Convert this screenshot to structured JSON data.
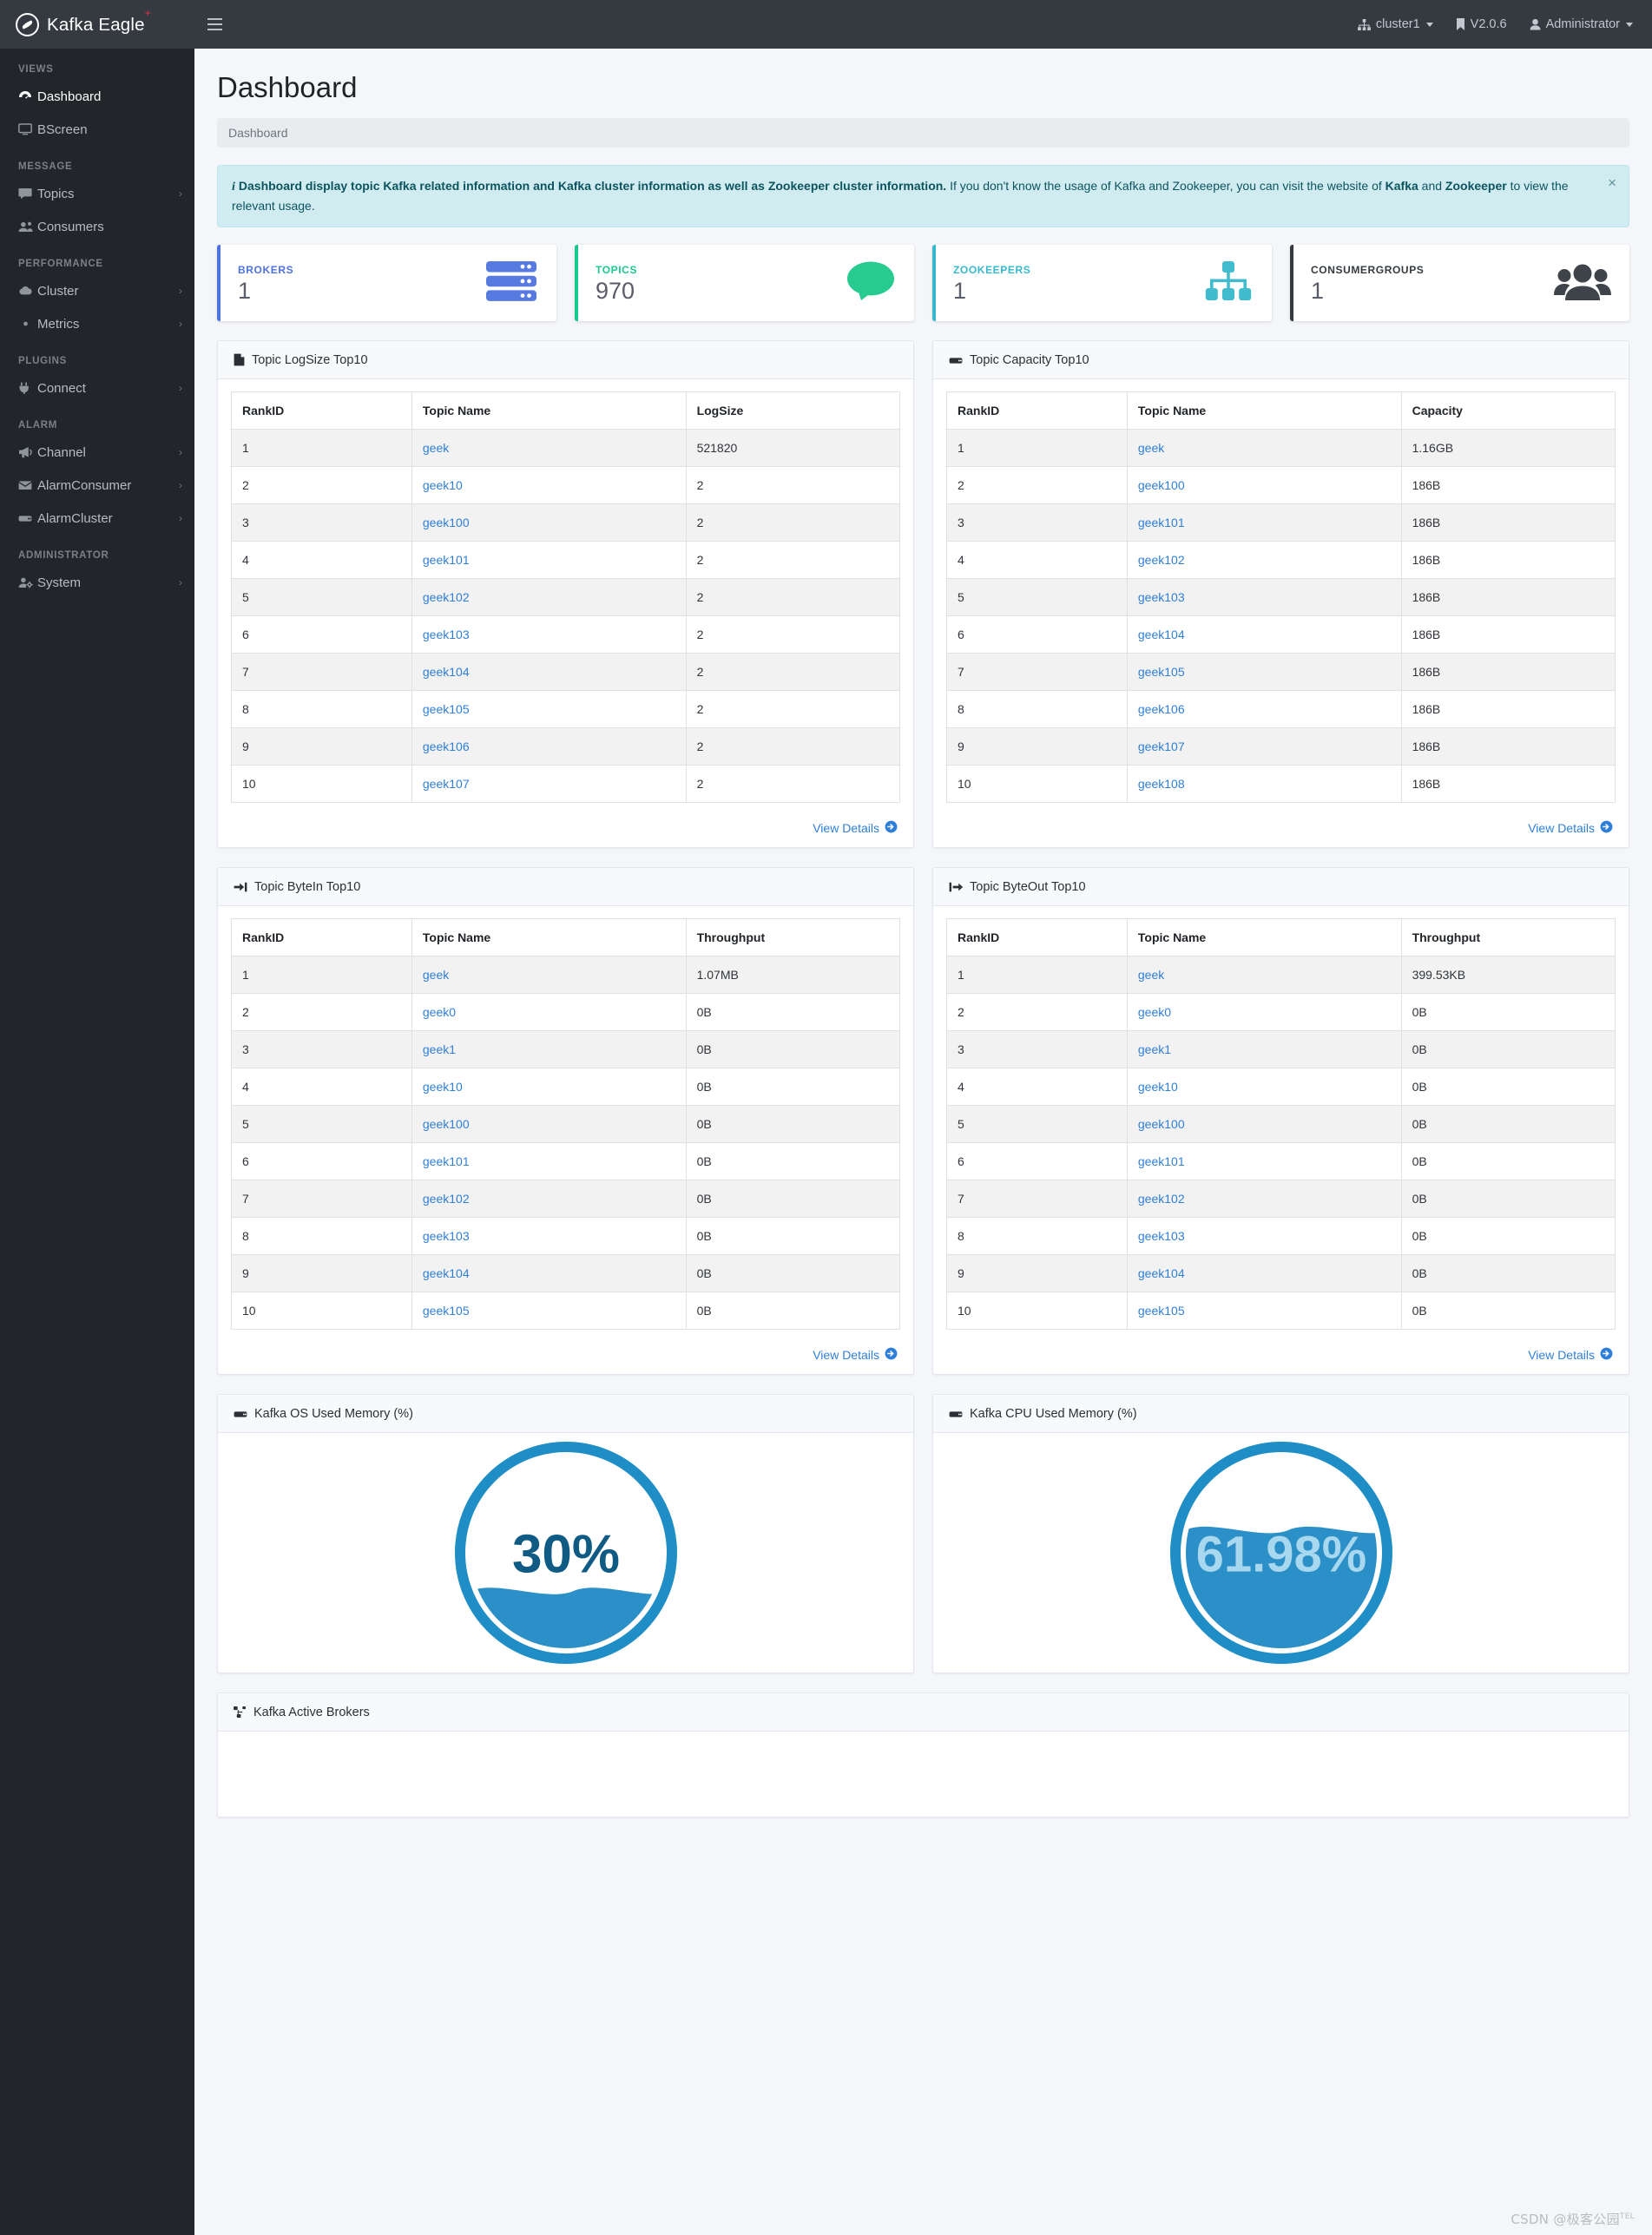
{
  "topnav": {
    "brand": "Kafka Eagle",
    "brand_sup": "+",
    "cluster": "cluster1",
    "version": "V2.0.6",
    "user": "Administrator"
  },
  "sidebar": {
    "sections": [
      {
        "heading": "VIEWS",
        "items": [
          {
            "label": "Dashboard",
            "icon": "dashboard-icon",
            "arrow": "",
            "active": true
          },
          {
            "label": "BScreen",
            "icon": "monitor-icon",
            "arrow": "",
            "active": false
          }
        ]
      },
      {
        "heading": "MESSAGE",
        "items": [
          {
            "label": "Topics",
            "icon": "comment-icon",
            "arrow": "›",
            "active": false
          },
          {
            "label": "Consumers",
            "icon": "users-icon",
            "arrow": "",
            "active": false
          }
        ]
      },
      {
        "heading": "PERFORMANCE",
        "items": [
          {
            "label": "Cluster",
            "icon": "cloud-icon",
            "arrow": "›",
            "active": false
          },
          {
            "label": "Metrics",
            "icon": "eye-icon",
            "arrow": "›",
            "active": false
          }
        ]
      },
      {
        "heading": "PLUGINS",
        "items": [
          {
            "label": "Connect",
            "icon": "plug-icon",
            "arrow": "›",
            "active": false
          }
        ]
      },
      {
        "heading": "ALARM",
        "items": [
          {
            "label": "Channel",
            "icon": "megaphone-icon",
            "arrow": "›",
            "active": false
          },
          {
            "label": "AlarmConsumer",
            "icon": "envelope-icon",
            "arrow": "›",
            "active": false
          },
          {
            "label": "AlarmCluster",
            "icon": "server-icon",
            "arrow": "›",
            "active": false
          }
        ]
      },
      {
        "heading": "ADMINISTRATOR",
        "items": [
          {
            "label": "System",
            "icon": "user-cog-icon",
            "arrow": "›",
            "active": false
          }
        ]
      }
    ]
  },
  "page": {
    "title": "Dashboard",
    "breadcrumb": "Dashboard"
  },
  "alert": {
    "part1": "Dashboard display topic Kafka related information and Kafka cluster information as well as Zookeeper cluster information.",
    "part2": "If you don't know the usage of Kafka and Zookeeper, you can visit the website of",
    "link1": "Kafka",
    "part3": "and",
    "link2": "Zookeeper",
    "part4": "to view the relevant usage.",
    "close": "×"
  },
  "stats": [
    {
      "label": "BROKERS",
      "value": "1",
      "color": "#4e73df",
      "icon": "server-stack-icon"
    },
    {
      "label": "TOPICS",
      "value": "970",
      "color": "#1cc88a",
      "icon": "comment-bubble-icon"
    },
    {
      "label": "ZOOKEEPERS",
      "value": "1",
      "color": "#36b9cc",
      "icon": "sitemap-icon"
    },
    {
      "label": "CONSUMERGROUPS",
      "value": "1",
      "color": "#343a40",
      "icon": "users-group-icon"
    }
  ],
  "tables": {
    "logsize": {
      "title": "Topic LogSize Top10",
      "icon": "file-icon",
      "columns": [
        "RankID",
        "Topic Name",
        "LogSize"
      ],
      "rows": [
        [
          "1",
          "geek",
          "521820"
        ],
        [
          "2",
          "geek10",
          "2"
        ],
        [
          "3",
          "geek100",
          "2"
        ],
        [
          "4",
          "geek101",
          "2"
        ],
        [
          "5",
          "geek102",
          "2"
        ],
        [
          "6",
          "geek103",
          "2"
        ],
        [
          "7",
          "geek104",
          "2"
        ],
        [
          "8",
          "geek105",
          "2"
        ],
        [
          "9",
          "geek106",
          "2"
        ],
        [
          "10",
          "geek107",
          "2"
        ]
      ],
      "footer_link": "View Details"
    },
    "capacity": {
      "title": "Topic Capacity Top10",
      "icon": "server-icon",
      "columns": [
        "RankID",
        "Topic Name",
        "Capacity"
      ],
      "rows": [
        [
          "1",
          "geek",
          "1.16GB"
        ],
        [
          "2",
          "geek100",
          "186B"
        ],
        [
          "3",
          "geek101",
          "186B"
        ],
        [
          "4",
          "geek102",
          "186B"
        ],
        [
          "5",
          "geek103",
          "186B"
        ],
        [
          "6",
          "geek104",
          "186B"
        ],
        [
          "7",
          "geek105",
          "186B"
        ],
        [
          "8",
          "geek106",
          "186B"
        ],
        [
          "9",
          "geek107",
          "186B"
        ],
        [
          "10",
          "geek108",
          "186B"
        ]
      ],
      "footer_link": "View Details"
    },
    "bytein": {
      "title": "Topic ByteIn Top10",
      "icon": "sign-in-icon",
      "columns": [
        "RankID",
        "Topic Name",
        "Throughput"
      ],
      "rows": [
        [
          "1",
          "geek",
          "1.07MB"
        ],
        [
          "2",
          "geek0",
          "0B"
        ],
        [
          "3",
          "geek1",
          "0B"
        ],
        [
          "4",
          "geek10",
          "0B"
        ],
        [
          "5",
          "geek100",
          "0B"
        ],
        [
          "6",
          "geek101",
          "0B"
        ],
        [
          "7",
          "geek102",
          "0B"
        ],
        [
          "8",
          "geek103",
          "0B"
        ],
        [
          "9",
          "geek104",
          "0B"
        ],
        [
          "10",
          "geek105",
          "0B"
        ]
      ],
      "footer_link": "View Details"
    },
    "byteout": {
      "title": "Topic ByteOut Top10",
      "icon": "sign-out-icon",
      "columns": [
        "RankID",
        "Topic Name",
        "Throughput"
      ],
      "rows": [
        [
          "1",
          "geek",
          "399.53KB"
        ],
        [
          "2",
          "geek0",
          "0B"
        ],
        [
          "3",
          "geek1",
          "0B"
        ],
        [
          "4",
          "geek10",
          "0B"
        ],
        [
          "5",
          "geek100",
          "0B"
        ],
        [
          "6",
          "geek101",
          "0B"
        ],
        [
          "7",
          "geek102",
          "0B"
        ],
        [
          "8",
          "geek103",
          "0B"
        ],
        [
          "9",
          "geek104",
          "0B"
        ],
        [
          "10",
          "geek105",
          "0B"
        ]
      ],
      "footer_link": "View Details"
    }
  },
  "gauges": {
    "os_memory": {
      "title": "Kafka OS Used Memory (%)",
      "icon": "server-icon",
      "label": "30%",
      "percent": 30
    },
    "cpu_memory": {
      "title": "Kafka CPU Used Memory (%)",
      "icon": "server-icon",
      "label": "61.98%",
      "percent": 61.98
    }
  },
  "active_brokers": {
    "title": "Kafka Active Brokers",
    "icon": "project-diagram-icon"
  },
  "watermark": {
    "text": "CSDN @极客公园",
    "sup": "TEL"
  },
  "chart_data": [
    {
      "type": "gauge",
      "title": "Kafka OS Used Memory (%)",
      "values": [
        30
      ],
      "labels": [
        "30%"
      ],
      "ylim": [
        0,
        100
      ],
      "style": "liquid-fill",
      "color": "#1f8dc6"
    },
    {
      "type": "gauge",
      "title": "Kafka CPU Used Memory (%)",
      "values": [
        61.98
      ],
      "labels": [
        "61.98%"
      ],
      "ylim": [
        0,
        100
      ],
      "style": "liquid-fill",
      "color": "#1f8dc6"
    }
  ]
}
